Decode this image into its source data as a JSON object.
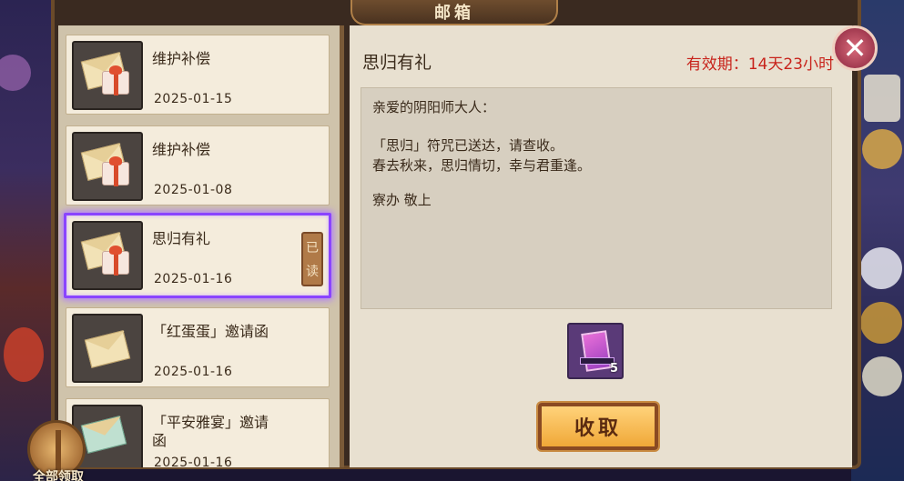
{
  "window": {
    "title": "邮箱"
  },
  "mails": [
    {
      "title": "维护补偿",
      "date": "2025-01-15",
      "selected": false,
      "read": false
    },
    {
      "title": "维护补偿",
      "date": "2025-01-08",
      "selected": false,
      "read": false
    },
    {
      "title": "思归有礼",
      "date": "2025-01-16",
      "selected": true,
      "read": true,
      "read_tag": [
        "已",
        "读"
      ]
    },
    {
      "title": "「红蛋蛋」邀请函",
      "date": "2025-01-16",
      "selected": false,
      "read": false
    },
    {
      "title_line1": "「平安雅宴」邀请",
      "title_line2": "函",
      "date": "2025-01-16",
      "selected": false,
      "read": false
    }
  ],
  "detail": {
    "title": "思归有礼",
    "validity": "有效期：14天23小时",
    "message": {
      "greeting": "亲爱的阴阳师大人：",
      "line1": "「思归」符咒已送达，请查收。",
      "line2": "春去秋来，思归情切，幸与君重逢。",
      "signature": "寮办 敬上"
    },
    "reward": {
      "icon": "talisman-card-icon",
      "quantity": "5"
    },
    "claim_label": "收取"
  },
  "claim_all_label": "全部领取",
  "close_icon": "close-icon",
  "colors": {
    "accent_red": "#c8241c",
    "selection": "#8a44ff",
    "button_gold": "#f0a838"
  }
}
